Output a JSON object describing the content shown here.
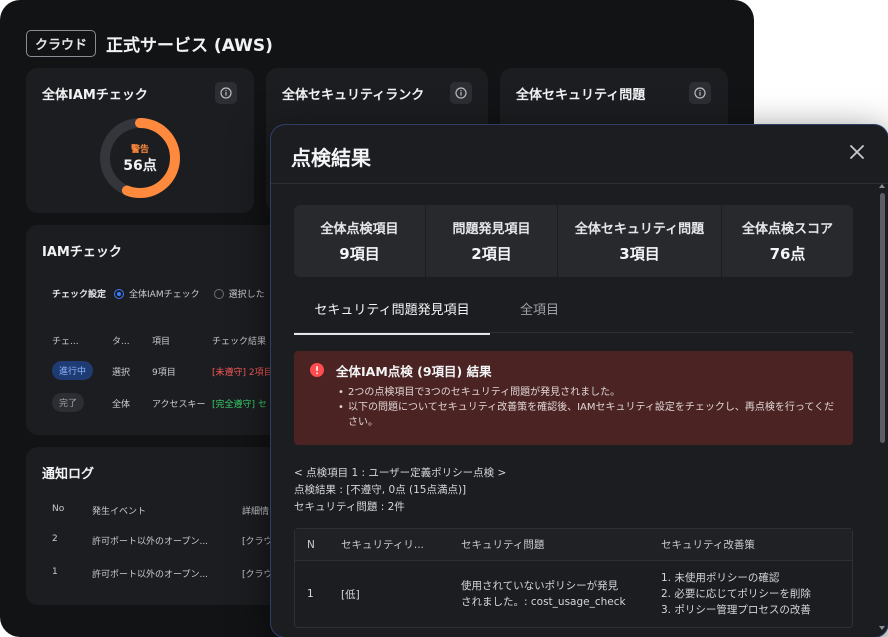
{
  "background": {
    "cloud_badge": "クラウド",
    "service_title": "正式サービス (AWS)",
    "cards": {
      "iam_check": {
        "title": "全体IAMチェック",
        "donut_label": "警告",
        "donut_value": "56点",
        "score_fraction": 0.56
      },
      "security_rank": {
        "title": "全体セキュリティランク"
      },
      "security_issues": {
        "title": "全体セキュリティ問題"
      }
    },
    "iam_section": {
      "title": "IAMチェック",
      "check_setting_label": "チェック設定",
      "radio_all": "全体IAMチェック",
      "radio_selected": "選択した",
      "headers": [
        "チェ...",
        "タ...",
        "項目",
        "チェック結果"
      ],
      "rows": [
        {
          "status": "進行中",
          "type": "選択",
          "item": "9項目",
          "result": "[未遵守] 2項目"
        },
        {
          "status": "完了",
          "type": "全体",
          "item": "アクセスキー",
          "result": "[完全遵守] セ"
        }
      ]
    },
    "notification_log": {
      "title": "通知ログ",
      "headers": [
        "No",
        "発生イベント",
        "詳細情"
      ],
      "rows": [
        {
          "no": "2",
          "event": "許可ポート以外のオープン...",
          "detail": "[クラウ"
        },
        {
          "no": "1",
          "event": "許可ポート以外のオープン...",
          "detail": "[クラウ"
        }
      ]
    }
  },
  "modal": {
    "title": "点検結果",
    "summary": [
      {
        "label": "全体点検項目",
        "value": "9項目"
      },
      {
        "label": "問題発見項目",
        "value": "2項目"
      },
      {
        "label": "全体セキュリティ問題",
        "value": "3項目"
      },
      {
        "label": "全体点検スコア",
        "value": "76点"
      }
    ],
    "tabs": {
      "active": "セキュリティ問題発見項目",
      "inactive": "全項目"
    },
    "alert": {
      "title": "全体IAM点検 (9項目) 結果",
      "bullets": [
        "2つの点検項目で3つのセキュリティ問題が発見されました。",
        "以下の問題についてセキュリティ改善策を確認後、IAMセキュリティ設定をチェックし、再点検を行ってください。"
      ]
    },
    "result_info": {
      "line1": "< 点検項目 1 : ユーザー定義ポリシー点検 >",
      "line2": "点検結果 : [不遵守, 0点 (15点満点)]",
      "line3": "セキュリティ問題 : 2件"
    },
    "table": {
      "headers": [
        "N",
        "セキュリティリ...",
        "セキュリティ問題",
        "セキュリティ改善策"
      ],
      "rows": [
        {
          "no": "1",
          "level": "[低]",
          "issue_line1": "使用されていないポリシーが発見",
          "issue_line2": "されました。: cost_usage_check",
          "fix_line1": "1. 未使用ポリシーの確認",
          "fix_line2": "2. 必要に応じてポリシーを削除",
          "fix_line3": "3. ポリシー管理プロセスの改善"
        }
      ]
    }
  }
}
